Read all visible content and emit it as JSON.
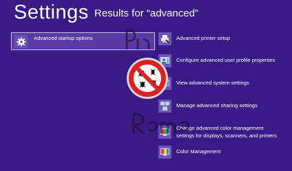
{
  "header": {
    "title": "Settings",
    "subtitle": "Results for “advanced”"
  },
  "results": [
    {
      "label": "Advanced startup options",
      "icon": "gear-icon",
      "selected": true
    },
    {
      "label": "Advanced printer setup",
      "icon": "printer-settings-icon"
    },
    {
      "label": "Configure advanced user profile properties",
      "icon": "user-profile-icon"
    },
    {
      "label": "View advanced system settings",
      "icon": "system-settings-icon"
    },
    {
      "label": "Manage advanced sharing settings",
      "icon": "network-sharing-icon"
    },
    {
      "label_line1": "Change advanced color management",
      "label_line2": "settings for displays, scanners, and printers",
      "icon": "color-management-icon"
    },
    {
      "label": "Color Management",
      "icon": "color-management-icon"
    }
  ],
  "colors": {
    "background": "#3a1a86",
    "selection_fill": "#5a3aa4",
    "selection_border": "#cfc6ea",
    "tile": "#6e55bd",
    "no_sign_red": "#e02020"
  }
}
